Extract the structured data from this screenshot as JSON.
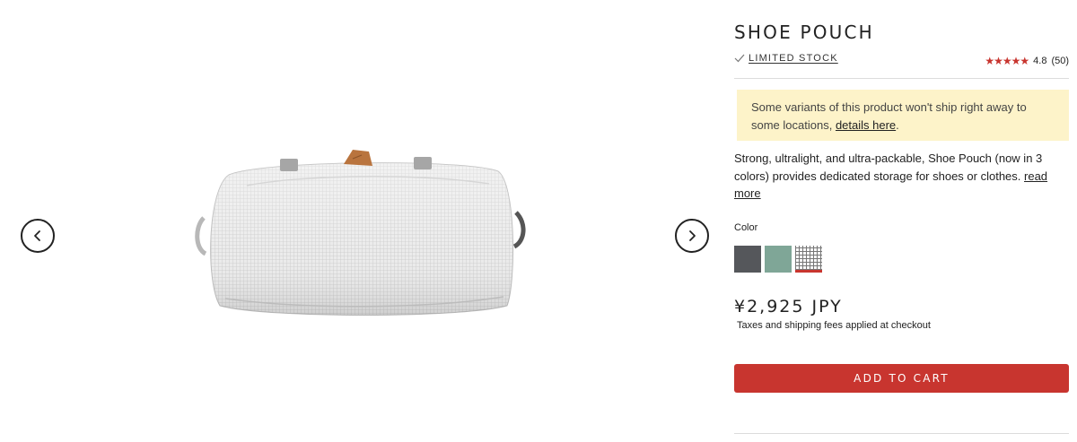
{
  "gallery": {
    "image_alt": "Shoe Pouch",
    "prev_icon": "chevron-left-icon",
    "next_icon": "chevron-right-icon"
  },
  "product": {
    "title": "SHOE POUCH",
    "stock_status": "LIMITED STOCK",
    "rating": {
      "stars": "★★★★★",
      "score": "4.8",
      "count": "(50)",
      "star_color": "#c8352f"
    },
    "notice": {
      "text": "Some variants of this product won't ship right away to some locations, ",
      "link": "details here",
      "suffix": ".",
      "background": "#fdf3c9"
    },
    "description": {
      "text": "Strong, ultralight, and ultra-packable, Shoe Pouch (now in 3 colors) provides dedicated storage for shoes or clothes. ",
      "link": "read more"
    },
    "color_label": "Color",
    "swatches": [
      {
        "name": "charcoal",
        "color": "#55575b",
        "selected": false
      },
      {
        "name": "sage",
        "color": "#7fa697",
        "selected": false
      },
      {
        "name": "raw",
        "color": "#f2f2f2",
        "selected": true
      }
    ],
    "price": "¥2,925 JPY",
    "taxes_note": "Taxes and shipping fees applied at checkout",
    "add_to_cart": "ADD TO CART",
    "accent": "#c8352f"
  }
}
